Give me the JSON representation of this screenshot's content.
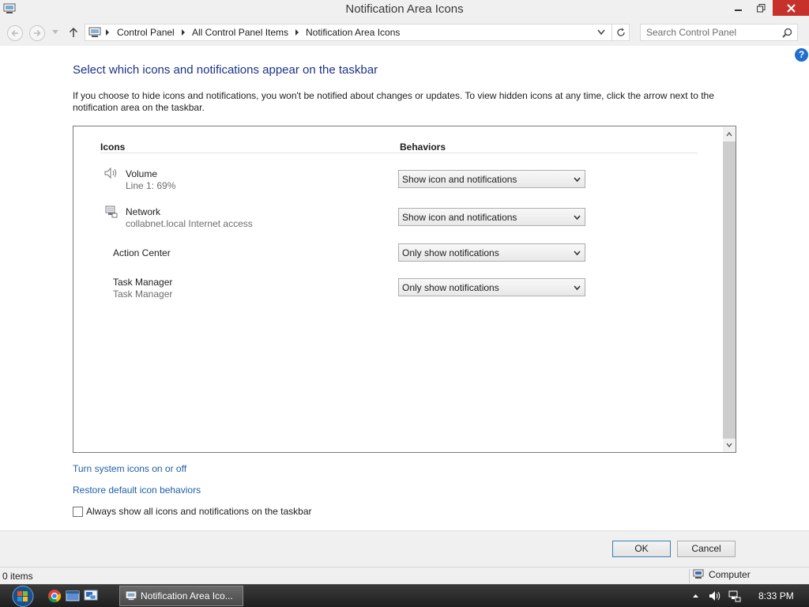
{
  "window": {
    "title": "Notification Area Icons"
  },
  "nav": {
    "breadcrumbs": [
      "Control Panel",
      "All Control Panel Items",
      "Notification Area Icons"
    ],
    "search_placeholder": "Search Control Panel"
  },
  "content": {
    "heading": "Select which icons and notifications appear on the taskbar",
    "description": "If you choose to hide icons and notifications, you won't be notified about changes or updates. To view hidden icons at any time, click the arrow next to the notification area on the taskbar.",
    "columns": {
      "icons": "Icons",
      "behaviors": "Behaviors"
    },
    "rows": [
      {
        "name": "Volume",
        "detail": "Line 1: 69%",
        "behavior": "Show icon and notifications",
        "icon": "speaker-icon"
      },
      {
        "name": "Network",
        "detail": "collabnet.local Internet access",
        "behavior": "Show icon and notifications",
        "icon": "network-icon"
      },
      {
        "name": "Action Center",
        "detail": "",
        "behavior": "Only show notifications",
        "icon": ""
      },
      {
        "name": "Task Manager",
        "detail": "Task Manager",
        "behavior": "Only show notifications",
        "icon": ""
      }
    ],
    "links": {
      "system_icons": "Turn system icons on or off",
      "restore": "Restore default icon behaviors"
    },
    "always_show_label": "Always show all icons and notifications on the taskbar",
    "always_show_checked": false
  },
  "buttons": {
    "ok": "OK",
    "cancel": "Cancel"
  },
  "status": {
    "items": "0 items",
    "zone": "Computer"
  },
  "taskbar": {
    "task_label": "Notification Area Ico...",
    "clock": "8:33 PM"
  },
  "colors": {
    "heading": "#1e3287",
    "link": "#1e5fa5",
    "close_button": "#c7312b"
  }
}
